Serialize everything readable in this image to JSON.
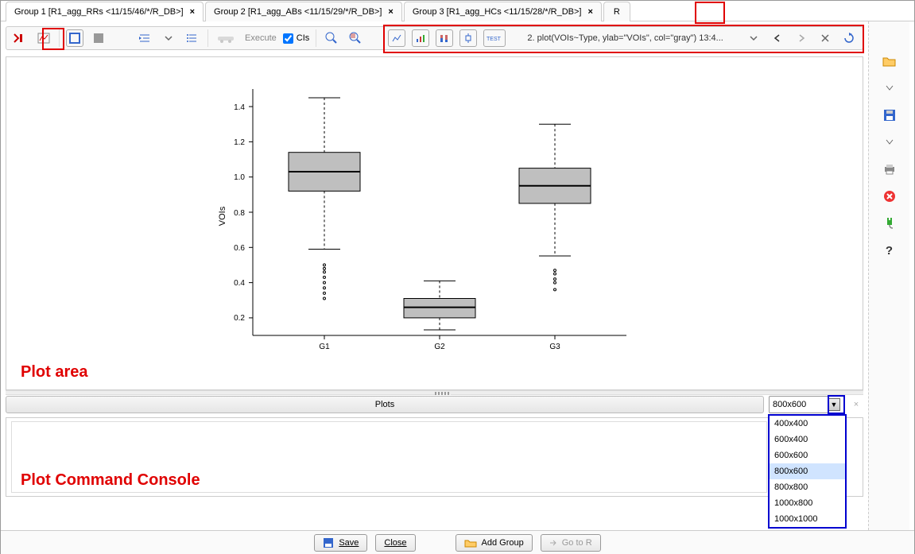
{
  "tabs": {
    "t1": "Group 1 [R1_agg_RRs <11/15/46/*/R_DB>]",
    "t2": "Group 2 [R1_agg_ABs <11/15/29/*/R_DB>]",
    "t3": "Group 3 [R1_agg_HCs <11/15/28/*/R_DB>]",
    "r": "R",
    "close": "×"
  },
  "toolbar": {
    "execute": "Execute",
    "cis": "CIs",
    "history": "2. plot(VOIs~Type, ylab=\"VOIs\", col=\"gray\") 13:4..."
  },
  "plot": {
    "ylabel": "VOIs",
    "ticks": {
      "y1": "0.2",
      "y2": "0.4",
      "y3": "0.6",
      "y4": "0.8",
      "y5": "1.0",
      "y6": "1.2",
      "y7": "1.4"
    },
    "x": {
      "g1": "G1",
      "g2": "G2",
      "g3": "G3"
    },
    "area_label": "Plot area"
  },
  "plotsbar": {
    "plots": "Plots",
    "size": "800x600"
  },
  "sizes": {
    "s1": "400x400",
    "s2": "600x400",
    "s3": "600x600",
    "s4": "800x600",
    "s5": "800x800",
    "s6": "1000x800",
    "s7": "1000x1000"
  },
  "console": {
    "label": "Plot Command Console"
  },
  "footer": {
    "save": "Save",
    "close": "Close",
    "addgroup": "Add Group",
    "gotor": "Go to R"
  },
  "chart_data": {
    "type": "boxplot",
    "ylabel": "VOIs",
    "ylim": [
      0.1,
      1.5
    ],
    "categories": [
      "G1",
      "G2",
      "G3"
    ],
    "series": [
      {
        "name": "G1",
        "min": 0.59,
        "q1": 0.92,
        "median": 1.03,
        "q3": 1.14,
        "max": 1.45,
        "outliers": [
          0.31,
          0.34,
          0.37,
          0.4,
          0.43,
          0.46,
          0.48,
          0.5
        ]
      },
      {
        "name": "G2",
        "min": 0.07,
        "q1": 0.2,
        "median": 0.26,
        "q3": 0.31,
        "max": 0.41,
        "outliers": []
      },
      {
        "name": "G3",
        "min": 0.55,
        "q1": 0.85,
        "median": 0.95,
        "q3": 1.05,
        "max": 1.3,
        "outliers": [
          0.36,
          0.4,
          0.42,
          0.45,
          0.47
        ]
      }
    ]
  }
}
